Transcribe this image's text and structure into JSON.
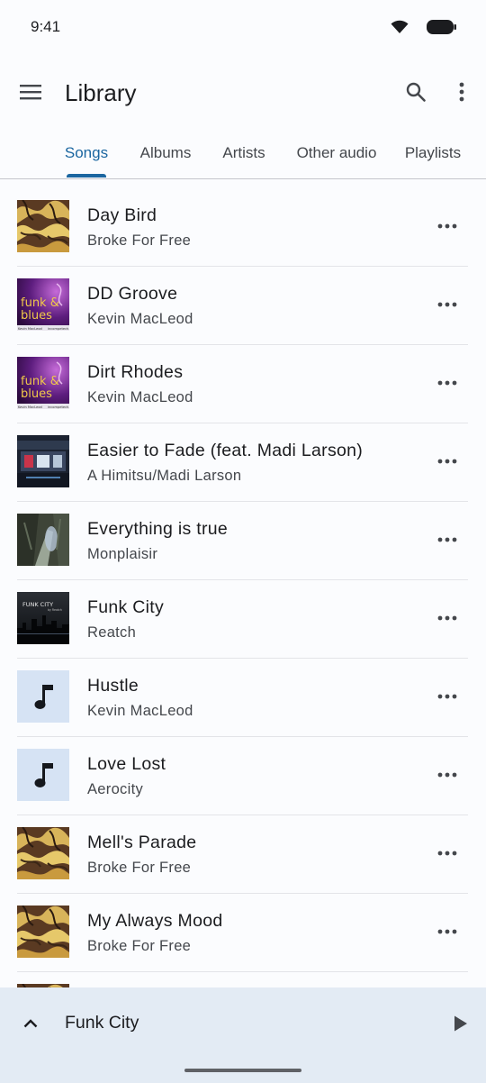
{
  "status_bar": {
    "time": "9:41"
  },
  "app_bar": {
    "title": "Library"
  },
  "tabs": [
    {
      "label": "Songs",
      "active": true
    },
    {
      "label": "Albums",
      "active": false
    },
    {
      "label": "Artists",
      "active": false
    },
    {
      "label": "Other audio",
      "active": false
    },
    {
      "label": "Playlists",
      "active": false
    }
  ],
  "songs": [
    {
      "title": "Day Bird",
      "artist": "Broke For Free",
      "art": "swirl-art"
    },
    {
      "title": "DD Groove",
      "artist": "Kevin MacLeod",
      "art": "funk-blues-art"
    },
    {
      "title": "Dirt Rhodes",
      "artist": "Kevin MacLeod",
      "art": "funk-blues-art"
    },
    {
      "title": "Easier to Fade (feat. Madi Larson)",
      "artist": "A Himitsu/Madi Larson",
      "art": "city-art"
    },
    {
      "title": "Everything is true",
      "artist": "Monplaisir",
      "art": "forest-art"
    },
    {
      "title": "Funk City",
      "artist": "Reatch",
      "art": "funk-city-art"
    },
    {
      "title": "Hustle",
      "artist": "Kevin MacLeod",
      "art": "music-note-placeholder"
    },
    {
      "title": "Love Lost",
      "artist": "Aerocity",
      "art": "music-note-placeholder"
    },
    {
      "title": "Mell's Parade",
      "artist": "Broke For Free",
      "art": "swirl-art"
    },
    {
      "title": "My Always Mood",
      "artist": "Broke For Free",
      "art": "swirl-art"
    },
    {
      "title": "",
      "artist": "",
      "art": "swirl-art"
    }
  ],
  "artwork_text": {
    "funk_blues_line1": "funk &",
    "funk_blues_line2": "blues",
    "funk_blues_credit": "Kevin MacLeod",
    "funk_blues_credit_site": "incompetech.com",
    "funk_city_label": "FUNK CITY",
    "funk_city_sub": "by Reatch"
  },
  "mini_player": {
    "title": "Funk City"
  },
  "colors": {
    "accent": "#1b66a0",
    "mini_player_bg": "#e3ebf4",
    "placeholder_bg": "#d6e3f4"
  }
}
